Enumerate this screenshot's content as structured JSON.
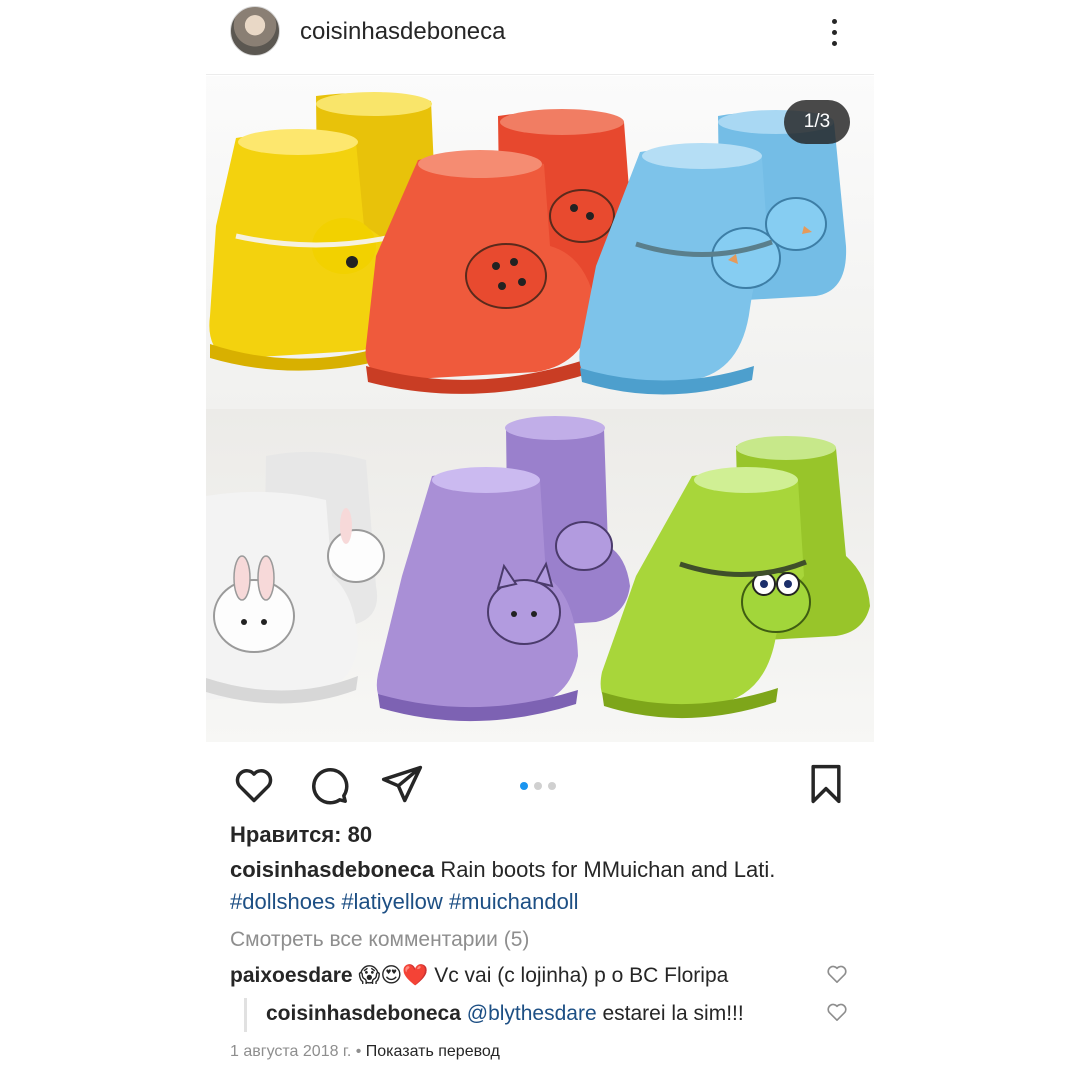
{
  "header": {
    "username": "coisinhasdeboneca"
  },
  "media": {
    "counter": "1/3",
    "page_count": 3,
    "current_page": 1
  },
  "likes": "Нравится: 80",
  "caption": {
    "username": "coisinhasdeboneca",
    "text": "Rain boots for MMuichan and Lati.",
    "hashtags": [
      "#dollshoes",
      "#latiyellow",
      "#muichandoll"
    ]
  },
  "view_all_comments": "Смотреть все комментарии (5)",
  "comments": [
    {
      "username": "paixoesdare",
      "emoji": "😱😍❤️",
      "text": "Vc vai (c lojinha) p o BC Floripa"
    },
    {
      "username": "coisinhasdeboneca",
      "mention": "@blythesdare",
      "text": "estarei la sim!!!"
    }
  ],
  "date": "1 августа 2018 г.",
  "separator": "•",
  "translate_label": "Показать перевод",
  "colors": {
    "accent_blue": "#1a95f0",
    "hashtag": "#1d4f84",
    "boot_yellow": "#f3d20e",
    "boot_red": "#ef5a3c",
    "boot_blue": "#7dc3ea",
    "boot_white": "#eeeeee",
    "boot_purple": "#a98fd6",
    "boot_green": "#a8d63a"
  },
  "icons": [
    "more-vertical-icon",
    "heart-icon",
    "comment-icon",
    "share-icon",
    "bookmark-icon"
  ]
}
